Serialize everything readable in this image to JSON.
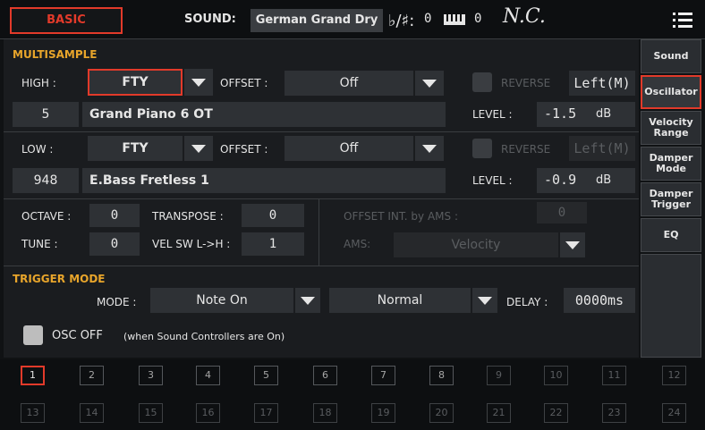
{
  "topbar": {
    "mode_button": "BASIC",
    "sound_label": "SOUND:",
    "sound_name": "German Grand Dry",
    "key_sig_value": "0",
    "keyboard_value": "0",
    "chord": "N.C."
  },
  "tabs": [
    {
      "label": "Sound"
    },
    {
      "label": "Oscillator"
    },
    {
      "label": "Velocity Range"
    },
    {
      "label": "Damper Mode"
    },
    {
      "label": "Damper Trigger"
    },
    {
      "label": "EQ"
    }
  ],
  "multisample": {
    "title": "MULTISAMPLE",
    "high": {
      "label": "HIGH :",
      "type": "FTY",
      "offset_label": "OFFSET :",
      "offset": "Off",
      "reverse_label": "REVERSE",
      "channel": "Left(M)",
      "number": "5",
      "name": "Grand Piano 6 OT",
      "level_label": "LEVEL :",
      "level": "-1.5",
      "level_unit": "dB"
    },
    "low": {
      "label": "LOW :",
      "type": "FTY",
      "offset_label": "OFFSET :",
      "offset": "Off",
      "reverse_label": "REVERSE",
      "channel": "Left(M)",
      "number": "948",
      "name": "E.Bass Fretless 1",
      "level_label": "LEVEL :",
      "level": "-0.9",
      "level_unit": "dB"
    }
  },
  "params": {
    "octave_label": "OCTAVE :",
    "octave": "0",
    "transpose_label": "TRANSPOSE :",
    "transpose": "0",
    "tune_label": "TUNE :",
    "tune": "0",
    "velsw_label": "VEL SW L->H :",
    "velsw": "1",
    "offset_int_label": "OFFSET INT. by AMS :",
    "offset_int": "0",
    "ams_label": "AMS:",
    "ams": "Velocity"
  },
  "trigger": {
    "title": "TRIGGER MODE",
    "mode_label": "MODE :",
    "mode": "Note On",
    "mode2": "Normal",
    "delay_label": "DELAY :",
    "delay": "0000ms",
    "osc_off_label": "OSC OFF",
    "osc_off_note": "(when Sound Controllers are On)"
  },
  "pads": [
    "1",
    "2",
    "3",
    "4",
    "5",
    "6",
    "7",
    "8",
    "9",
    "10",
    "11",
    "12",
    "13",
    "14",
    "15",
    "16",
    "17",
    "18",
    "19",
    "20",
    "21",
    "22",
    "23",
    "24"
  ],
  "colors": {
    "accent": "#e23a2a",
    "section": "#e8a52b",
    "field": "#2e3135"
  }
}
